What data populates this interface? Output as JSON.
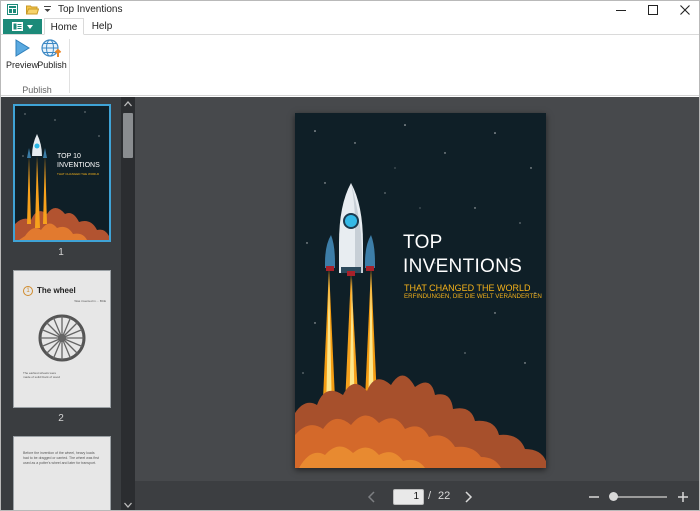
{
  "window": {
    "title": "Top Inventions"
  },
  "ribbon": {
    "tabs": [
      {
        "label": "Home"
      },
      {
        "label": "Help"
      }
    ],
    "buttons": [
      {
        "label": "Preview",
        "icon": "play-triangle-icon"
      },
      {
        "label": "Publish",
        "icon": "globe-upload-icon"
      }
    ],
    "group_label": "Publish"
  },
  "thumbnails": [
    {
      "page": "1",
      "selected": true,
      "title": "TOP 10",
      "title2": "INVENTIONS",
      "subtitle": "THAT CHANGED THE WORLD"
    },
    {
      "page": "2",
      "selected": false,
      "number": "1",
      "heading": "The wheel",
      "side_note": "Was invented in ... BCE",
      "caption": "The earliest wheels were made of solid block of wood"
    },
    {
      "page": "3",
      "selected": false,
      "text": "Before the invention of the wheel, heavy loads had to be dragged or carried. The wheel was first used as a potter's wheel and later for transport."
    }
  ],
  "cover": {
    "title_line1": "TOP",
    "title_line2": "INVENTIONS",
    "subtitle": "THAT CHANGED THE WORLD",
    "subtitle_de": "ERFINDUNGEN, DIE DIE WELT VERÄNDERTEN",
    "background": "#0f1f27",
    "accent": "#f5b21a"
  },
  "pager": {
    "current": "1",
    "separator": "/",
    "total": "22"
  },
  "colors": {
    "file_button": "#1c8a79",
    "panel": "#3a3d40",
    "workspace": "#47494c",
    "selection": "#3fa3d6"
  }
}
